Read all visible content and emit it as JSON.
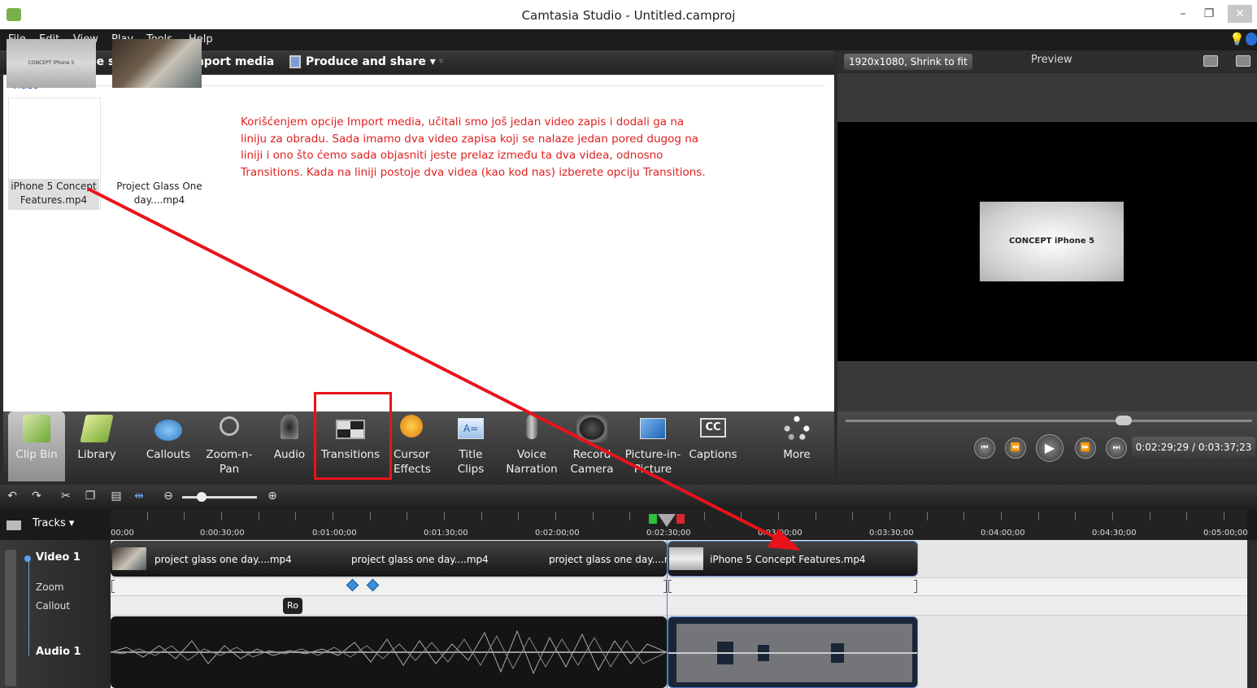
{
  "window": {
    "title": "Camtasia Studio - Untitled.camproj",
    "minimize": "–",
    "restore": "❐",
    "close": "✕"
  },
  "menu": [
    "File",
    "Edit",
    "View",
    "Play",
    "Tools",
    "Help"
  ],
  "toolbar": {
    "record": "Record the screen ▾",
    "import": "Import media",
    "produce": "Produce and share ▾",
    "overflow": "▿"
  },
  "clipbin": {
    "section": "Video",
    "clips": [
      {
        "name_line1": "iPhone 5 Concept",
        "name_line2": "Features.mp4",
        "thumb_text": "CONCEPT iPhone 5"
      },
      {
        "name_line1": "Project Glass One",
        "name_line2": "day....mp4"
      }
    ],
    "annotation": "Korišćenjem opcije Import media, učitali smo još jedan video zapis i dodali ga na liniju za obradu. Sada imamo dva video zapisa koji se nalaze jedan pored dugog na liniji i ono što ćemo sada objasniti jeste prelaz između ta dva videa, odnosno Transitions. Kada na liniji postoje dva videa (kao kod nas) izberete opciju Transitions."
  },
  "preview": {
    "resolution": "1920x1080, Shrink to fit ▾",
    "label": "Preview",
    "clip_text": "CONCEPT iPhone 5",
    "time": "0:02:29;29 / 0:03:37;23"
  },
  "tools": [
    {
      "l1": "Clip Bin",
      "l2": ""
    },
    {
      "l1": "Library",
      "l2": ""
    },
    {
      "l1": "Callouts",
      "l2": ""
    },
    {
      "l1": "Zoom-n-",
      "l2": "Pan"
    },
    {
      "l1": "Audio",
      "l2": ""
    },
    {
      "l1": "Transitions",
      "l2": ""
    },
    {
      "l1": "Cursor",
      "l2": "Effects"
    },
    {
      "l1": "Title",
      "l2": "Clips"
    },
    {
      "l1": "Voice",
      "l2": "Narration"
    },
    {
      "l1": "Record",
      "l2": "Camera"
    },
    {
      "l1": "Picture-in-",
      "l2": "Picture"
    },
    {
      "l1": "Captions",
      "l2": ""
    },
    {
      "l1": "More",
      "l2": ""
    }
  ],
  "timeline": {
    "tracks_label": "Tracks ▾",
    "ticks": [
      "00;00",
      "0:00:30;00",
      "0:01:00;00",
      "0:01:30;00",
      "0:02:00;00",
      "0:02:30;00",
      "0:03:00;00",
      "0:03:30;00",
      "0:04:00;00",
      "0:04:30;00",
      "0:05:00;00"
    ],
    "video_track": "Video 1",
    "zoom_track": "Zoom",
    "callout_track": "Callout",
    "audio_track": "Audio 1",
    "video_clips": [
      "project glass one day....mp4",
      "project glass one day....mp4",
      "project glass one day....mp",
      "iPhone 5 Concept Features.mp4"
    ],
    "callout_text": "Ro"
  },
  "colors": {
    "annotation": "#e02020",
    "highlight": "#e8131b",
    "playhead": "#4d7cc9"
  }
}
